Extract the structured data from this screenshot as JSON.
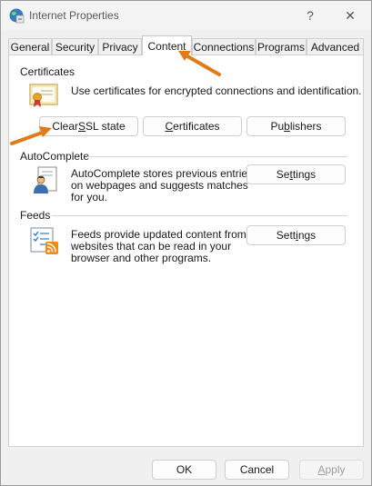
{
  "window": {
    "title": "Internet Properties",
    "help_glyph": "?",
    "close_glyph": "✕"
  },
  "tabs": [
    {
      "label": "General"
    },
    {
      "label": "Security"
    },
    {
      "label": "Privacy"
    },
    {
      "label": "Content",
      "active": true
    },
    {
      "label": "Connections"
    },
    {
      "label": "Programs"
    },
    {
      "label": "Advanced"
    }
  ],
  "certificates": {
    "heading": "Certificates",
    "description": "Use certificates for encrypted connections and identification.",
    "clear_ssl_label_pre": "Clear ",
    "clear_ssl_label_ul": "S",
    "clear_ssl_label_post": "SL state",
    "certificates_label_ul": "C",
    "certificates_label_post": "ertificates",
    "publishers_label_pre": "Pu",
    "publishers_label_ul": "b",
    "publishers_label_post": "lishers"
  },
  "autocomplete": {
    "heading": "AutoComplete",
    "desc_line1": "AutoComplete stores previous entries",
    "desc_line2": "on webpages and suggests matches",
    "desc_line3": "for you.",
    "settings_label_pre": "Se",
    "settings_label_ul": "t",
    "settings_label_post": "tings"
  },
  "feeds": {
    "heading": "Feeds",
    "desc_line1": "Feeds provide updated content from",
    "desc_line2": "websites that can be read in your",
    "desc_line3": "browser and other programs.",
    "settings_label_pre": "Sett",
    "settings_label_ul": "i",
    "settings_label_post": "ngs"
  },
  "footer": {
    "ok": "OK",
    "cancel": "Cancel",
    "apply_ul": "A",
    "apply_post": "pply"
  },
  "colors": {
    "annotation_arrow": "#e07b1a"
  }
}
